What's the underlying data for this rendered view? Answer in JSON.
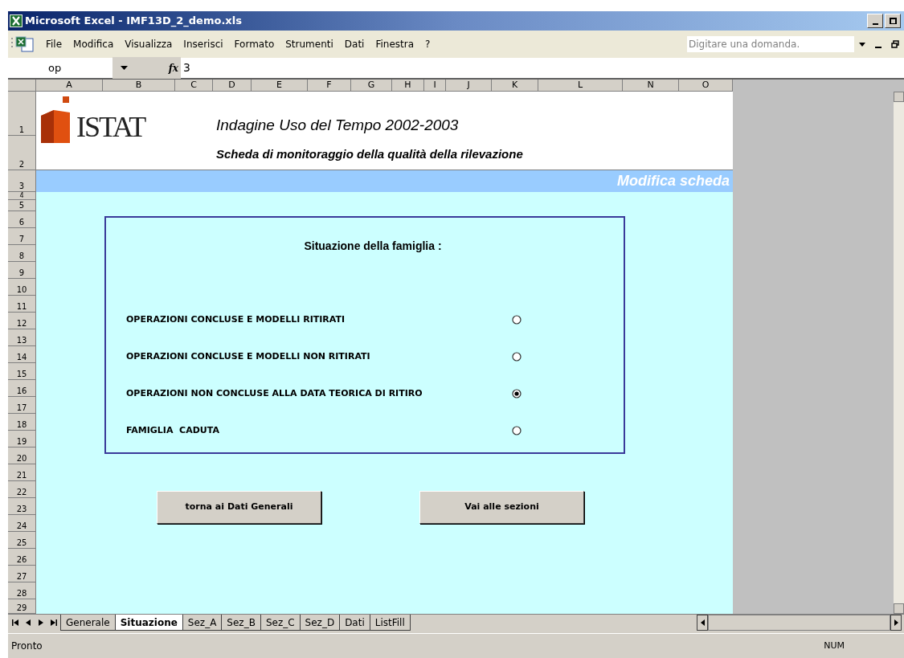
{
  "window": {
    "title": "Microsoft Excel - IMF13D_2_demo.xls"
  },
  "menu": [
    "File",
    "Modifica",
    "Visualizza",
    "Inserisci",
    "Formato",
    "Strumenti",
    "Dati",
    "Finestra",
    "?"
  ],
  "help_search": {
    "placeholder": "Digitare una domanda."
  },
  "formula_bar": {
    "name_box": "op",
    "function_label": "fx",
    "formula": "3"
  },
  "columns": [
    "A",
    "B",
    "C",
    "D",
    "E",
    "F",
    "G",
    "H",
    "I",
    "J",
    "K",
    "L",
    "N",
    "O"
  ],
  "rows": [
    "1",
    "2",
    "3",
    "4",
    "5",
    "6",
    "7",
    "8",
    "9",
    "10",
    "11",
    "12",
    "13",
    "14",
    "15",
    "16",
    "17",
    "18",
    "19",
    "20",
    "21",
    "22",
    "23",
    "24",
    "25",
    "26",
    "27",
    "28",
    "29"
  ],
  "sheet": {
    "logo_text": "ISTAT",
    "title": "Indagine Uso del Tempo 2002-2003",
    "subtitle": "Scheda di monitoraggio della qualità della rilevazione",
    "banner": "Modifica scheda"
  },
  "form": {
    "heading": "Situazione della famiglia :",
    "options": [
      {
        "label": "OPERAZIONI CONCLUSE E MODELLI RITIRATI",
        "selected": false
      },
      {
        "label": "OPERAZIONI CONCLUSE E MODELLI NON RITIRATI",
        "selected": false
      },
      {
        "label": "OPERAZIONI NON CONCLUSE ALLA DATA TEORICA DI RITIRO",
        "selected": true
      },
      {
        "label": "FAMIGLIA  CADUTA",
        "selected": false
      }
    ],
    "buttons": [
      "torna ai Dati Generali",
      "Vai alle sezioni"
    ]
  },
  "sheet_tabs": [
    {
      "label": "Generale",
      "selected": false
    },
    {
      "label": "Situazione",
      "selected": true
    },
    {
      "label": "Sez_A",
      "selected": false
    },
    {
      "label": "Sez_B",
      "selected": false
    },
    {
      "label": "Sez_C",
      "selected": false
    },
    {
      "label": "Sez_D",
      "selected": false
    },
    {
      "label": "Dati",
      "selected": false
    },
    {
      "label": "ListFill",
      "selected": false
    }
  ],
  "status_bar": {
    "text": "Pronto",
    "indicator": "NUM"
  }
}
